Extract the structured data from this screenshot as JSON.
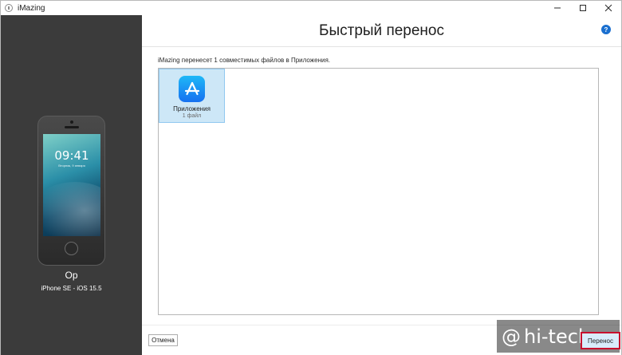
{
  "window": {
    "title": "iMazing",
    "controls": [
      "minimize",
      "maximize",
      "close"
    ]
  },
  "device": {
    "name": "Op",
    "info": "iPhone SE - iOS 15.5",
    "lock_time": "09:41",
    "lock_date": "Вторник, 9 января"
  },
  "main": {
    "title": "Быстрый перенос",
    "help_label": "?",
    "message": "iMazing перенесет 1 совместимых файлов в Приложения.",
    "tiles": [
      {
        "label": "Приложения",
        "count": "1 файл",
        "icon": "app-store-icon",
        "selected": true
      }
    ],
    "cancel_label": "Отмена",
    "transfer_label": "Перенос"
  },
  "watermark": {
    "symbol": "@",
    "text": "hi-tech"
  },
  "colors": {
    "device_panel": "#3b3b3b",
    "tile_selected": "#cde7f7",
    "help": "#1a6fcf",
    "highlight_border": "#c8102e"
  }
}
